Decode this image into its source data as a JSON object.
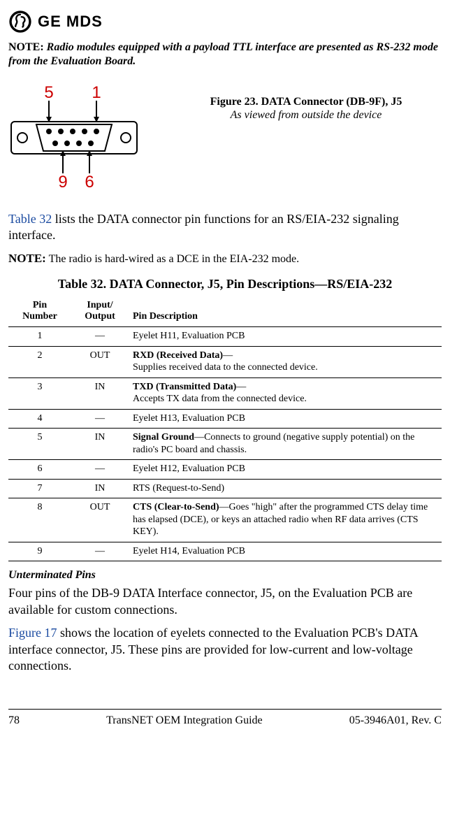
{
  "header": {
    "brand": "GE MDS"
  },
  "note1": {
    "label": "NOTE:",
    "body": "Radio modules equipped with a payload TTL interface are presented as RS-232 mode from the Evaluation Board."
  },
  "figure": {
    "labels": {
      "tl": "5",
      "tr": "1",
      "bl": "9",
      "br": "6"
    },
    "caption_title": "Figure 23. DATA Connector (DB-9F), J5",
    "caption_sub": "As viewed from outside the device"
  },
  "intro_para": {
    "link_text": "Table 32",
    "rest": " lists the DATA connector pin functions for an RS/EIA-232 signaling interface."
  },
  "note2": {
    "label": "NOTE:",
    "body": "The radio is hard-wired as a DCE in the EIA-232 mode."
  },
  "table": {
    "title": "Table 32. DATA Connector, J5, Pin Descriptions—RS/EIA-232",
    "headers": {
      "pin_l1": "Pin",
      "pin_l2": "Number",
      "io_l1": "Input/",
      "io_l2": "Output",
      "desc": "Pin Description"
    },
    "rows": [
      {
        "num": "1",
        "io": "—",
        "main": "",
        "rest": "Eyelet H11, Evaluation PCB"
      },
      {
        "num": "2",
        "io": "OUT",
        "main": "RXD (Received Data)",
        "dash": "—",
        "rest": "Supplies received data to the connected device."
      },
      {
        "num": "3",
        "io": "IN",
        "main": "TXD (Transmitted Data)",
        "dash": "—",
        "rest": "Accepts TX data from the connected device."
      },
      {
        "num": "4",
        "io": "—",
        "main": "",
        "rest": "Eyelet H13, Evaluation PCB"
      },
      {
        "num": "5",
        "io": "IN",
        "main": "Signal Ground",
        "dash": "—",
        "rest": "Connects to ground (negative supply potential) on the radio's PC board and chassis."
      },
      {
        "num": "6",
        "io": "—",
        "main": "",
        "rest": "Eyelet H12, Evaluation PCB"
      },
      {
        "num": "7",
        "io": "IN",
        "main": "",
        "rest": "RTS (Request-to-Send)"
      },
      {
        "num": "8",
        "io": "OUT",
        "main": "CTS (Clear-to-Send)",
        "dash": "—",
        "rest": "Goes \"high\" after the programmed CTS delay time has elapsed (DCE), or keys an attached radio when RF data arrives (CTS KEY)."
      },
      {
        "num": "9",
        "io": "—",
        "main": "",
        "rest": "Eyelet H14, Evaluation PCB"
      }
    ]
  },
  "subhead": "Unterminated Pins",
  "body1": "Four pins of the DB-9 DATA Interface connector, J5, on the Evaluation PCB are available for custom connections.",
  "body2": {
    "link_text": "Figure 17",
    "rest": " shows the location of eyelets connected to the Evaluation PCB's DATA interface connector, J5. These pins are provided for low-current and low-voltage connections."
  },
  "footer": {
    "page": "78",
    "title": "TransNET OEM Integration Guide",
    "doc": "05-3946A01, Rev. C"
  }
}
